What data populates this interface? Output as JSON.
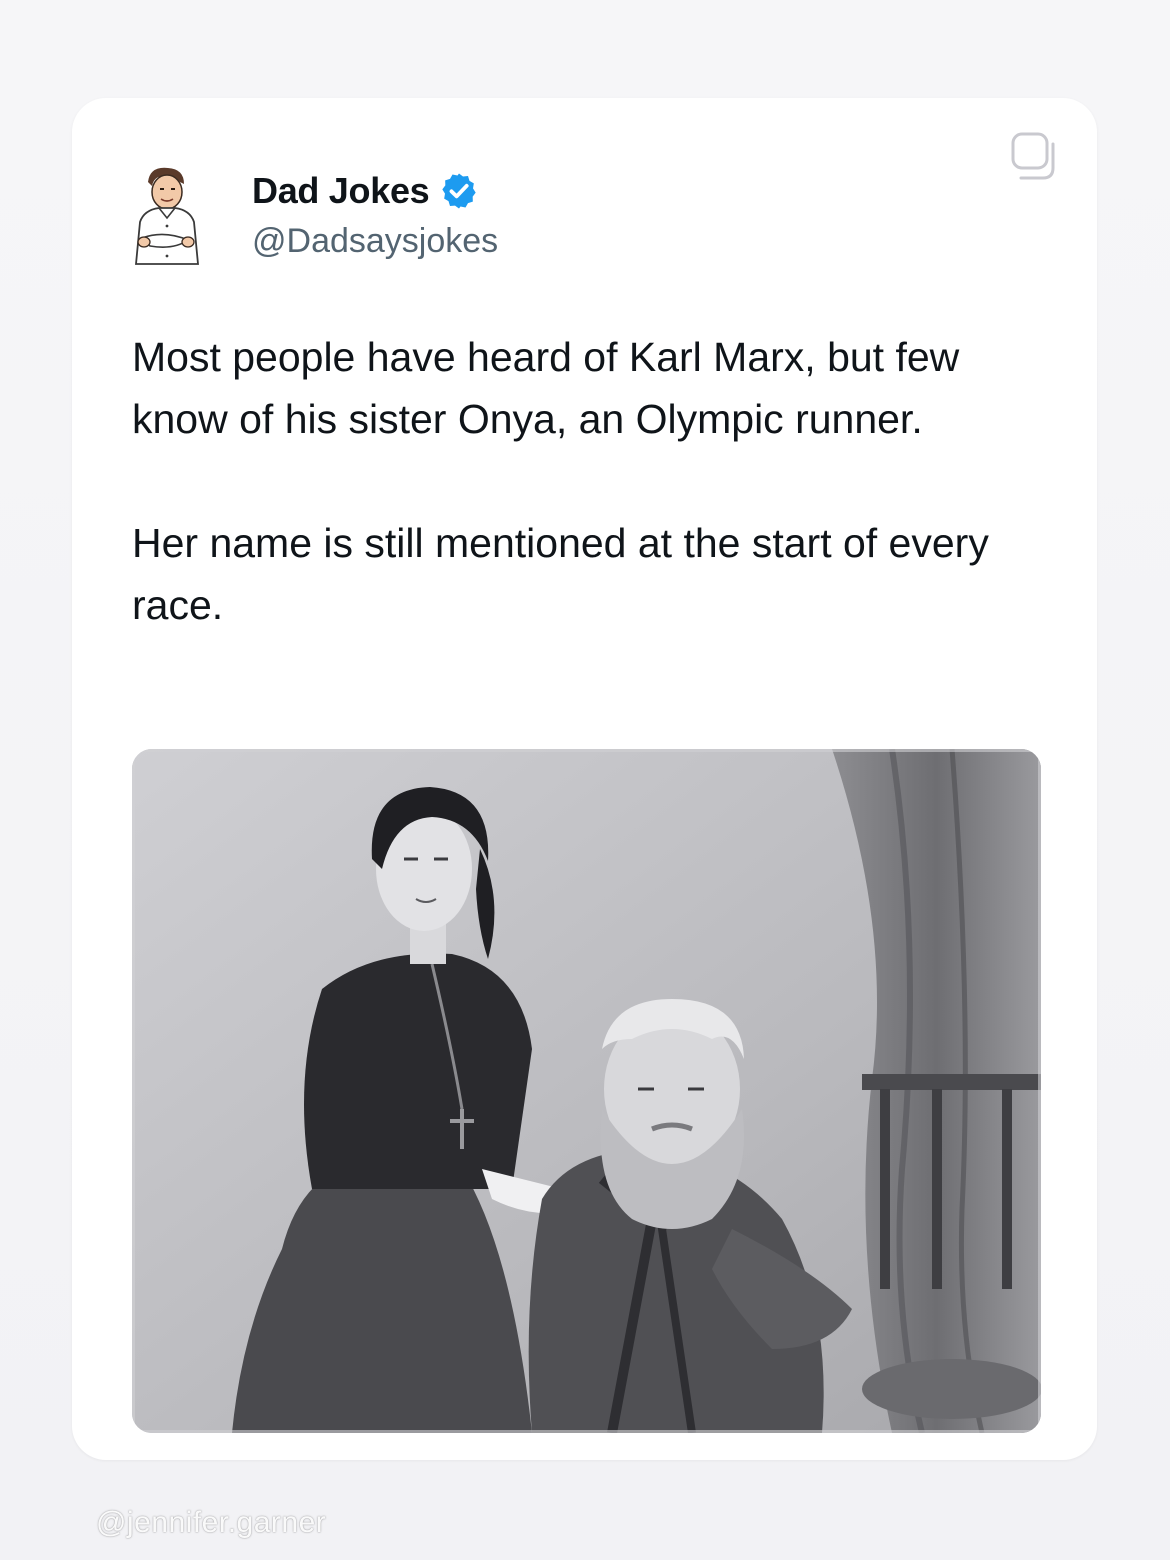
{
  "tweet": {
    "author": {
      "display_name": "Dad Jokes",
      "handle": "@Dadsaysjokes",
      "verified": true,
      "avatar_icon": "cartoon-dad-avatar"
    },
    "text_paragraphs": [
      "Most people have heard of Karl Marx, but few know of his sister Onya, an Olympic runner.",
      "Her name is still mentioned at the start of every race."
    ],
    "media": {
      "kind": "photo",
      "tone": "black-and-white"
    },
    "copy_icon": "copy-icon"
  },
  "watermark": "@jennifer.garner",
  "colors": {
    "verified_blue": "#1d9bf0",
    "text_primary": "#0f1419",
    "text_secondary": "#536471"
  }
}
